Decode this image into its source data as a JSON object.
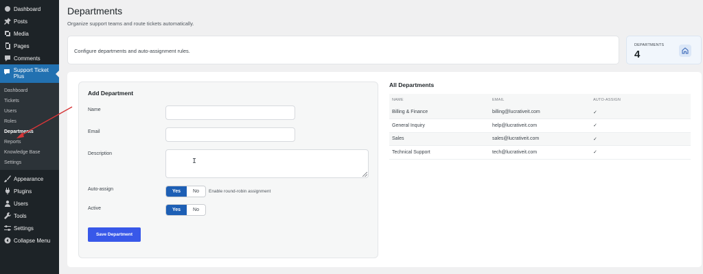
{
  "sidebar": {
    "top_items": [
      {
        "label": "Dashboard",
        "icon": "dashboard-icon"
      },
      {
        "label": "Posts",
        "icon": "pin-icon"
      },
      {
        "label": "Media",
        "icon": "media-icon"
      },
      {
        "label": "Pages",
        "icon": "pages-icon"
      },
      {
        "label": "Comments",
        "icon": "comment-icon"
      }
    ],
    "active_item": {
      "label": "Support Ticket Plus",
      "icon": "support-icon"
    },
    "submenu": [
      "Dashboard",
      "Tickets",
      "Users",
      "Roles",
      "Departments",
      "Reports",
      "Knowledge Base",
      "Settings"
    ],
    "current_submenu": "Departments",
    "bottom_items": [
      {
        "label": "Appearance",
        "icon": "brush-icon"
      },
      {
        "label": "Plugins",
        "icon": "plug-icon"
      },
      {
        "label": "Users",
        "icon": "users-icon"
      },
      {
        "label": "Tools",
        "icon": "wrench-icon"
      },
      {
        "label": "Settings",
        "icon": "settings-icon"
      },
      {
        "label": "Collapse Menu",
        "icon": "collapse-icon"
      }
    ]
  },
  "header": {
    "title": "Departments",
    "subtitle": "Organize support teams and route tickets automatically."
  },
  "info_bar": {
    "text": "Configure departments and auto-assignment rules."
  },
  "stat": {
    "label": "DEPARTMENTS",
    "value": "4",
    "icon": "home-icon"
  },
  "form": {
    "title": "Add Department",
    "name_label": "Name",
    "name_value": "",
    "email_label": "Email",
    "email_value": "",
    "description_label": "Description",
    "description_value": "",
    "autoassign_label": "Auto-assign",
    "autoassign_yes": "Yes",
    "autoassign_no": "No",
    "autoassign_hint": "Enable round-robin assignment",
    "active_label": "Active",
    "active_yes": "Yes",
    "active_no": "No",
    "save_label": "Save Department"
  },
  "list": {
    "title": "All Departments",
    "columns": [
      "NAME",
      "EMAIL",
      "AUTO-ASSIGN"
    ],
    "rows": [
      {
        "name": "Billing & Finance",
        "email": "billing@lucrativeit.com",
        "auto": "✓"
      },
      {
        "name": "General Inquiry",
        "email": "help@lucrativeit.com",
        "auto": "✓"
      },
      {
        "name": "Sales",
        "email": "sales@lucrativeit.com",
        "auto": "✓"
      },
      {
        "name": "Technical Support",
        "email": "tech@lucrativeit.com",
        "auto": "✓"
      }
    ]
  },
  "colors": {
    "sidebar_bg": "#1d2327",
    "active_menu": "#2271b1",
    "primary_button": "#3858e9",
    "toggle_on": "#1d5fb5",
    "annotation_arrow": "#d63638"
  }
}
